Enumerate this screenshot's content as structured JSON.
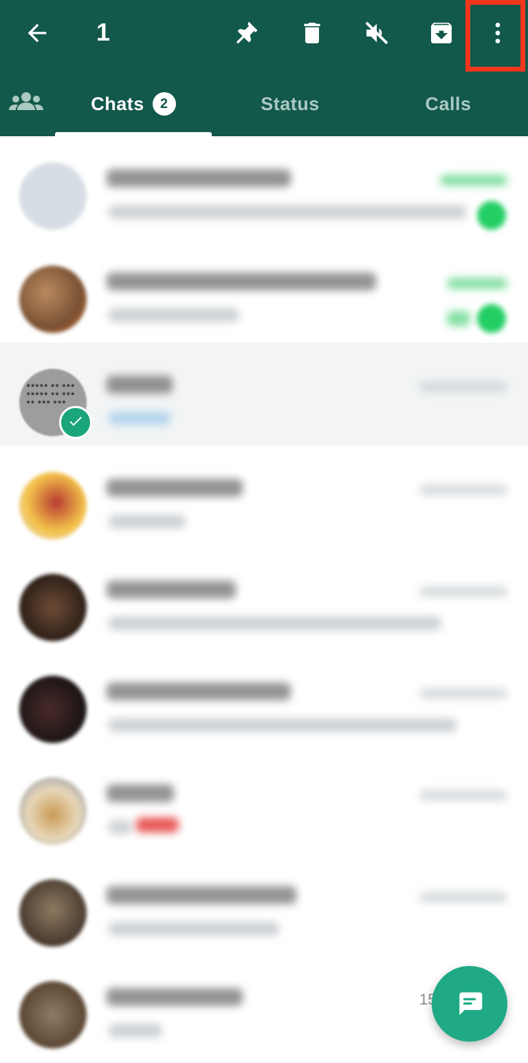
{
  "selection": {
    "count": "1"
  },
  "icons": {
    "back": "arrow-left-icon",
    "pin": "pin-icon",
    "delete": "trash-icon",
    "mute": "mute-icon",
    "archive": "archive-icon",
    "more": "more-vertical-icon",
    "communities": "communities-icon",
    "new_chat": "new-chat-icon"
  },
  "tabs": [
    {
      "label": "Chats",
      "badge": "2",
      "active": true
    },
    {
      "label": "Status"
    },
    {
      "label": "Calls"
    }
  ],
  "fab_partial_time": "15",
  "colors": {
    "header": "#12584b",
    "highlight": "#f1361e",
    "fab": "#1faa85",
    "unread": "#23cf64"
  }
}
